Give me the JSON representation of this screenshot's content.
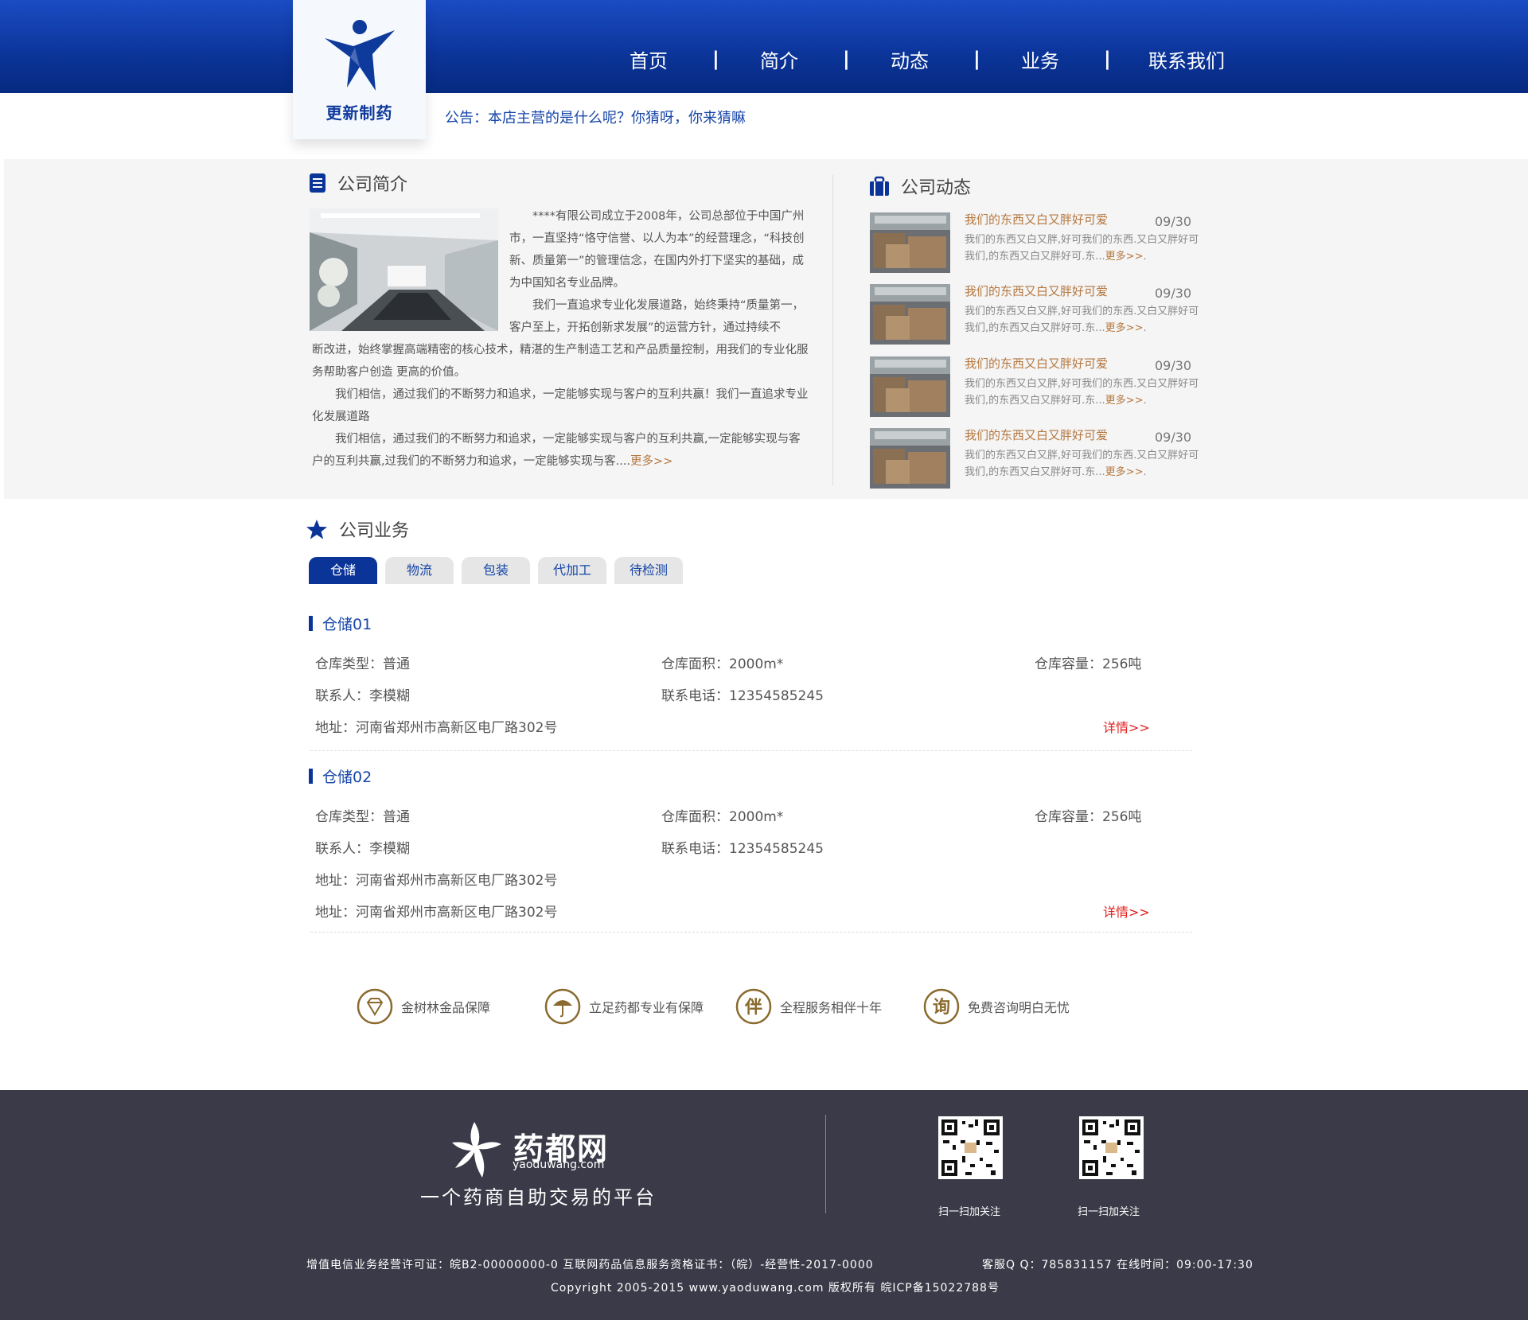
{
  "header": {
    "logo_text": "更新制药",
    "nav": [
      "首页",
      "简介",
      "动态",
      "业务",
      "联系我们"
    ],
    "nav_separator": "|",
    "notice": "公告：本店主营的是什么呢？你猜呀，你来猜嘛"
  },
  "intro": {
    "title": "公司简介",
    "paragraphs": [
      "****有限公司成立于2008年，公司总部位于中国广州市，一直坚持“恪守信誉、以人为本”的经营理念，“科技创新、质量第一”的管理信念，在国内外打下坚实的基础，成为中国知名专业品牌。",
      "我们一直追求专业化发展道路，始终秉持“质量第一，客户至上，开拓创新求发展”的运营方针，通过持续不　　断改进，始终掌握高端精密的核心技术，精湛的生产制造工艺和产品质量控制，用我们的专业化服务帮助客户创造 更高的价值。",
      "我们相信，通过我们的不断努力和追求，一定能够实现与客户的互利共赢！我们一直追求专业化发展道路",
      "我们相信，通过我们的不断努力和追求，一定能够实现与客户的互利共赢,一定能够实现与客户的互利共赢,过我们的不断努力和追求，一定能够实现与客...."
    ],
    "more": "更多>>"
  },
  "news": {
    "title": "公司动态",
    "items": [
      {
        "title": "我们的东西又白又胖好可爱",
        "date": "09/30",
        "desc": "我们的东西又白又胖,好可我们的东西.又白又胖好可我们,的东西又白又胖好可.东...",
        "more": "更多>>",
        "tail": "."
      },
      {
        "title": "我们的东西又白又胖好可爱",
        "date": "09/30",
        "desc": "我们的东西又白又胖,好可我们的东西.又白又胖好可我们,的东西又白又胖好可.东...",
        "more": "更多>>",
        "tail": "."
      },
      {
        "title": "我们的东西又白又胖好可爱",
        "date": "09/30",
        "desc": "我们的东西又白又胖,好可我们的东西.又白又胖好可我们,的东西又白又胖好可.东...",
        "more": "更多>>",
        "tail": "."
      },
      {
        "title": "我们的东西又白又胖好可爱",
        "date": "09/30",
        "desc": "我们的东西又白又胖,好可我们的东西.又白又胖好可我们,的东西又白又胖好可.东...",
        "more": "更多>>",
        "tail": "."
      }
    ]
  },
  "business": {
    "title": "公司业务",
    "tabs": [
      "仓储",
      "物流",
      "包装",
      "代加工",
      "待检测"
    ],
    "active_tab": "仓储",
    "warehouses": [
      {
        "name": "仓储01",
        "type": "仓库类型：普通",
        "area": "仓库面积：2000m*",
        "capacity": "仓库容量：256吨",
        "contact": "联系人：李模糊",
        "phone": "联系电话：12354585245",
        "addresses": [
          "地址：河南省郑州市高新区电厂路302号"
        ],
        "detail": "详情>>"
      },
      {
        "name": "仓储02",
        "type": "仓库类型：普通",
        "area": "仓库面积：2000m*",
        "capacity": "仓库容量：256吨",
        "contact": "联系人：李模糊",
        "phone": "联系电话：12354585245",
        "addresses": [
          "地址：河南省郑州市高新区电厂路302号",
          "地址：河南省郑州市高新区电厂路302号"
        ],
        "detail": "详情>>"
      }
    ]
  },
  "features": [
    {
      "icon": "diamond-icon",
      "label": "金树林金品保障"
    },
    {
      "icon": "umbrella-icon",
      "label": "立足药都专业有保障"
    },
    {
      "icon": "companion-icon",
      "label": "全程服务相伴十年",
      "glyph": "伴"
    },
    {
      "icon": "consult-icon",
      "label": "免费咨询明白无忧",
      "glyph": "询"
    }
  ],
  "footer": {
    "brand_cn": "药都网",
    "brand_en": "yaoduwang.com",
    "slogan": "一个药商自助交易的平台",
    "qr_captions": [
      "扫一扫加关注",
      "扫一扫加关注"
    ],
    "license": "增值电信业务经营许可证：皖B2-00000000-0 互联网药品信息服务资格证书：（皖）-经营性-2017-0000",
    "service": "客服Q Q：785831157 在线时间：09:00-17:30",
    "copyright": "Copyright 2005-2015 www.yaoduwang.com 版权所有 皖ICP备15022788号"
  },
  "colors": {
    "brand_blue": "#0b3498",
    "accent_brown": "#b5773f",
    "detail_red": "#e0201d",
    "footer_bg": "#3a3a48"
  }
}
